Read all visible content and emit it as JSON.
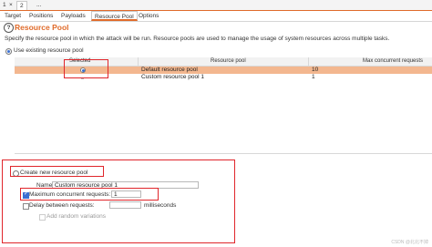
{
  "numbered_tabs": [
    "1",
    "2",
    "..."
  ],
  "tabs": [
    "Target",
    "Positions",
    "Payloads",
    "Resource Pool",
    "Options"
  ],
  "header": {
    "help_icon_glyph": "?",
    "title": "Resource Pool",
    "description": "Specify the resource pool in which the attack will be run. Resource pools are used to manage the usage of system resources across multiple tasks."
  },
  "existing": {
    "label": "Use existing resource pool",
    "columns": [
      "Selected",
      "Resource pool",
      "Max concurrent requests"
    ],
    "rows": [
      {
        "name": "Default resource pool",
        "max": "10",
        "selected": true
      },
      {
        "name": "Custom resource pool 1",
        "max": "1",
        "selected": false
      }
    ]
  },
  "create": {
    "label": "Create new resource pool",
    "name_label": "Name:",
    "name_value": "Custom resource pool 1",
    "max_label": "Maximum concurrent requests:",
    "max_value": "1",
    "delay_label": "Delay between requests:",
    "delay_value": "",
    "delay_unit": "milliseconds",
    "random_label": "Add random variations"
  },
  "watermark": "CSDN @北北不掉"
}
